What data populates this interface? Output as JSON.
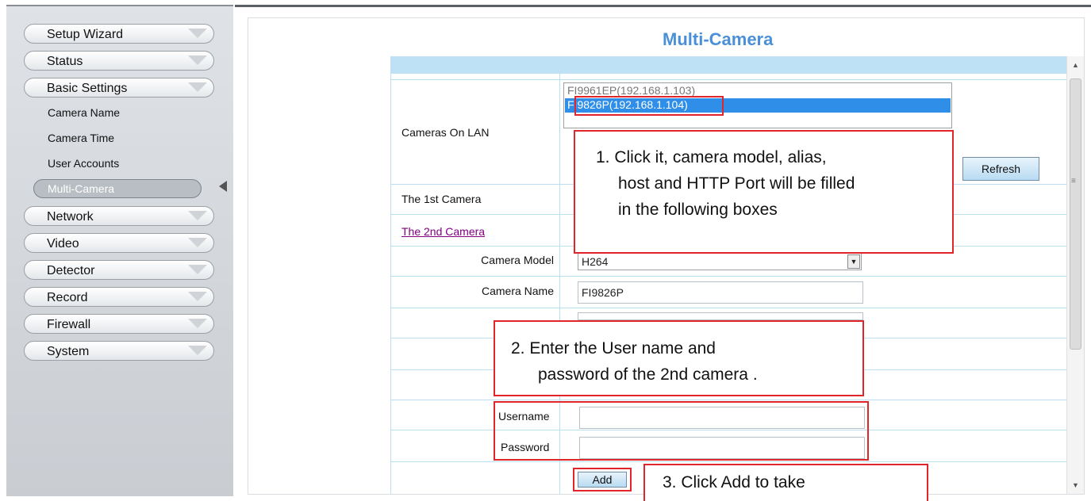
{
  "sidebar": {
    "menu": [
      {
        "label": "Setup Wizard"
      },
      {
        "label": "Status"
      },
      {
        "label": "Basic Settings"
      }
    ],
    "sub_items": [
      {
        "label": "Camera Name"
      },
      {
        "label": "Camera Time"
      },
      {
        "label": "User Accounts"
      }
    ],
    "active_sub": "Multi-Camera",
    "menu_after": [
      {
        "label": "Network"
      },
      {
        "label": "Video"
      },
      {
        "label": "Detector"
      },
      {
        "label": "Record"
      },
      {
        "label": "Firewall"
      },
      {
        "label": "System"
      }
    ]
  },
  "main": {
    "title": "Multi-Camera",
    "cameras_on_lan": {
      "label": "Cameras On LAN",
      "options": [
        "FI9961EP(192.168.1.103)",
        "FI9826P(192.168.1.104)"
      ],
      "selected": "FI9826P(192.168.1.104)",
      "refresh_label": "Refresh"
    },
    "first_camera_label": "The 1st Camera",
    "second_camera_label": "The 2nd Camera",
    "camera_model": {
      "label": "Camera Model",
      "value": "H264"
    },
    "camera_name": {
      "label": "Camera Name",
      "value": "FI9826P"
    },
    "username": {
      "label": "Username",
      "value": ""
    },
    "password": {
      "label": "Password",
      "value": ""
    },
    "add_label": "Add"
  },
  "annotations": {
    "callout1_line1": "1. Click it, camera model, alias,",
    "callout1_line2": "host and HTTP Port will be filled",
    "callout1_line3": "in the following boxes",
    "callout2_line1": "2. Enter the User name and",
    "callout2_line2": "password of the 2nd camera .",
    "callout3_line1": "3. Click Add to take"
  },
  "colors": {
    "title_blue": "#4a90d9",
    "selection_blue": "#2f8fe8",
    "annotation_red": "#e0262a",
    "table_header": "#bfe1f5"
  }
}
